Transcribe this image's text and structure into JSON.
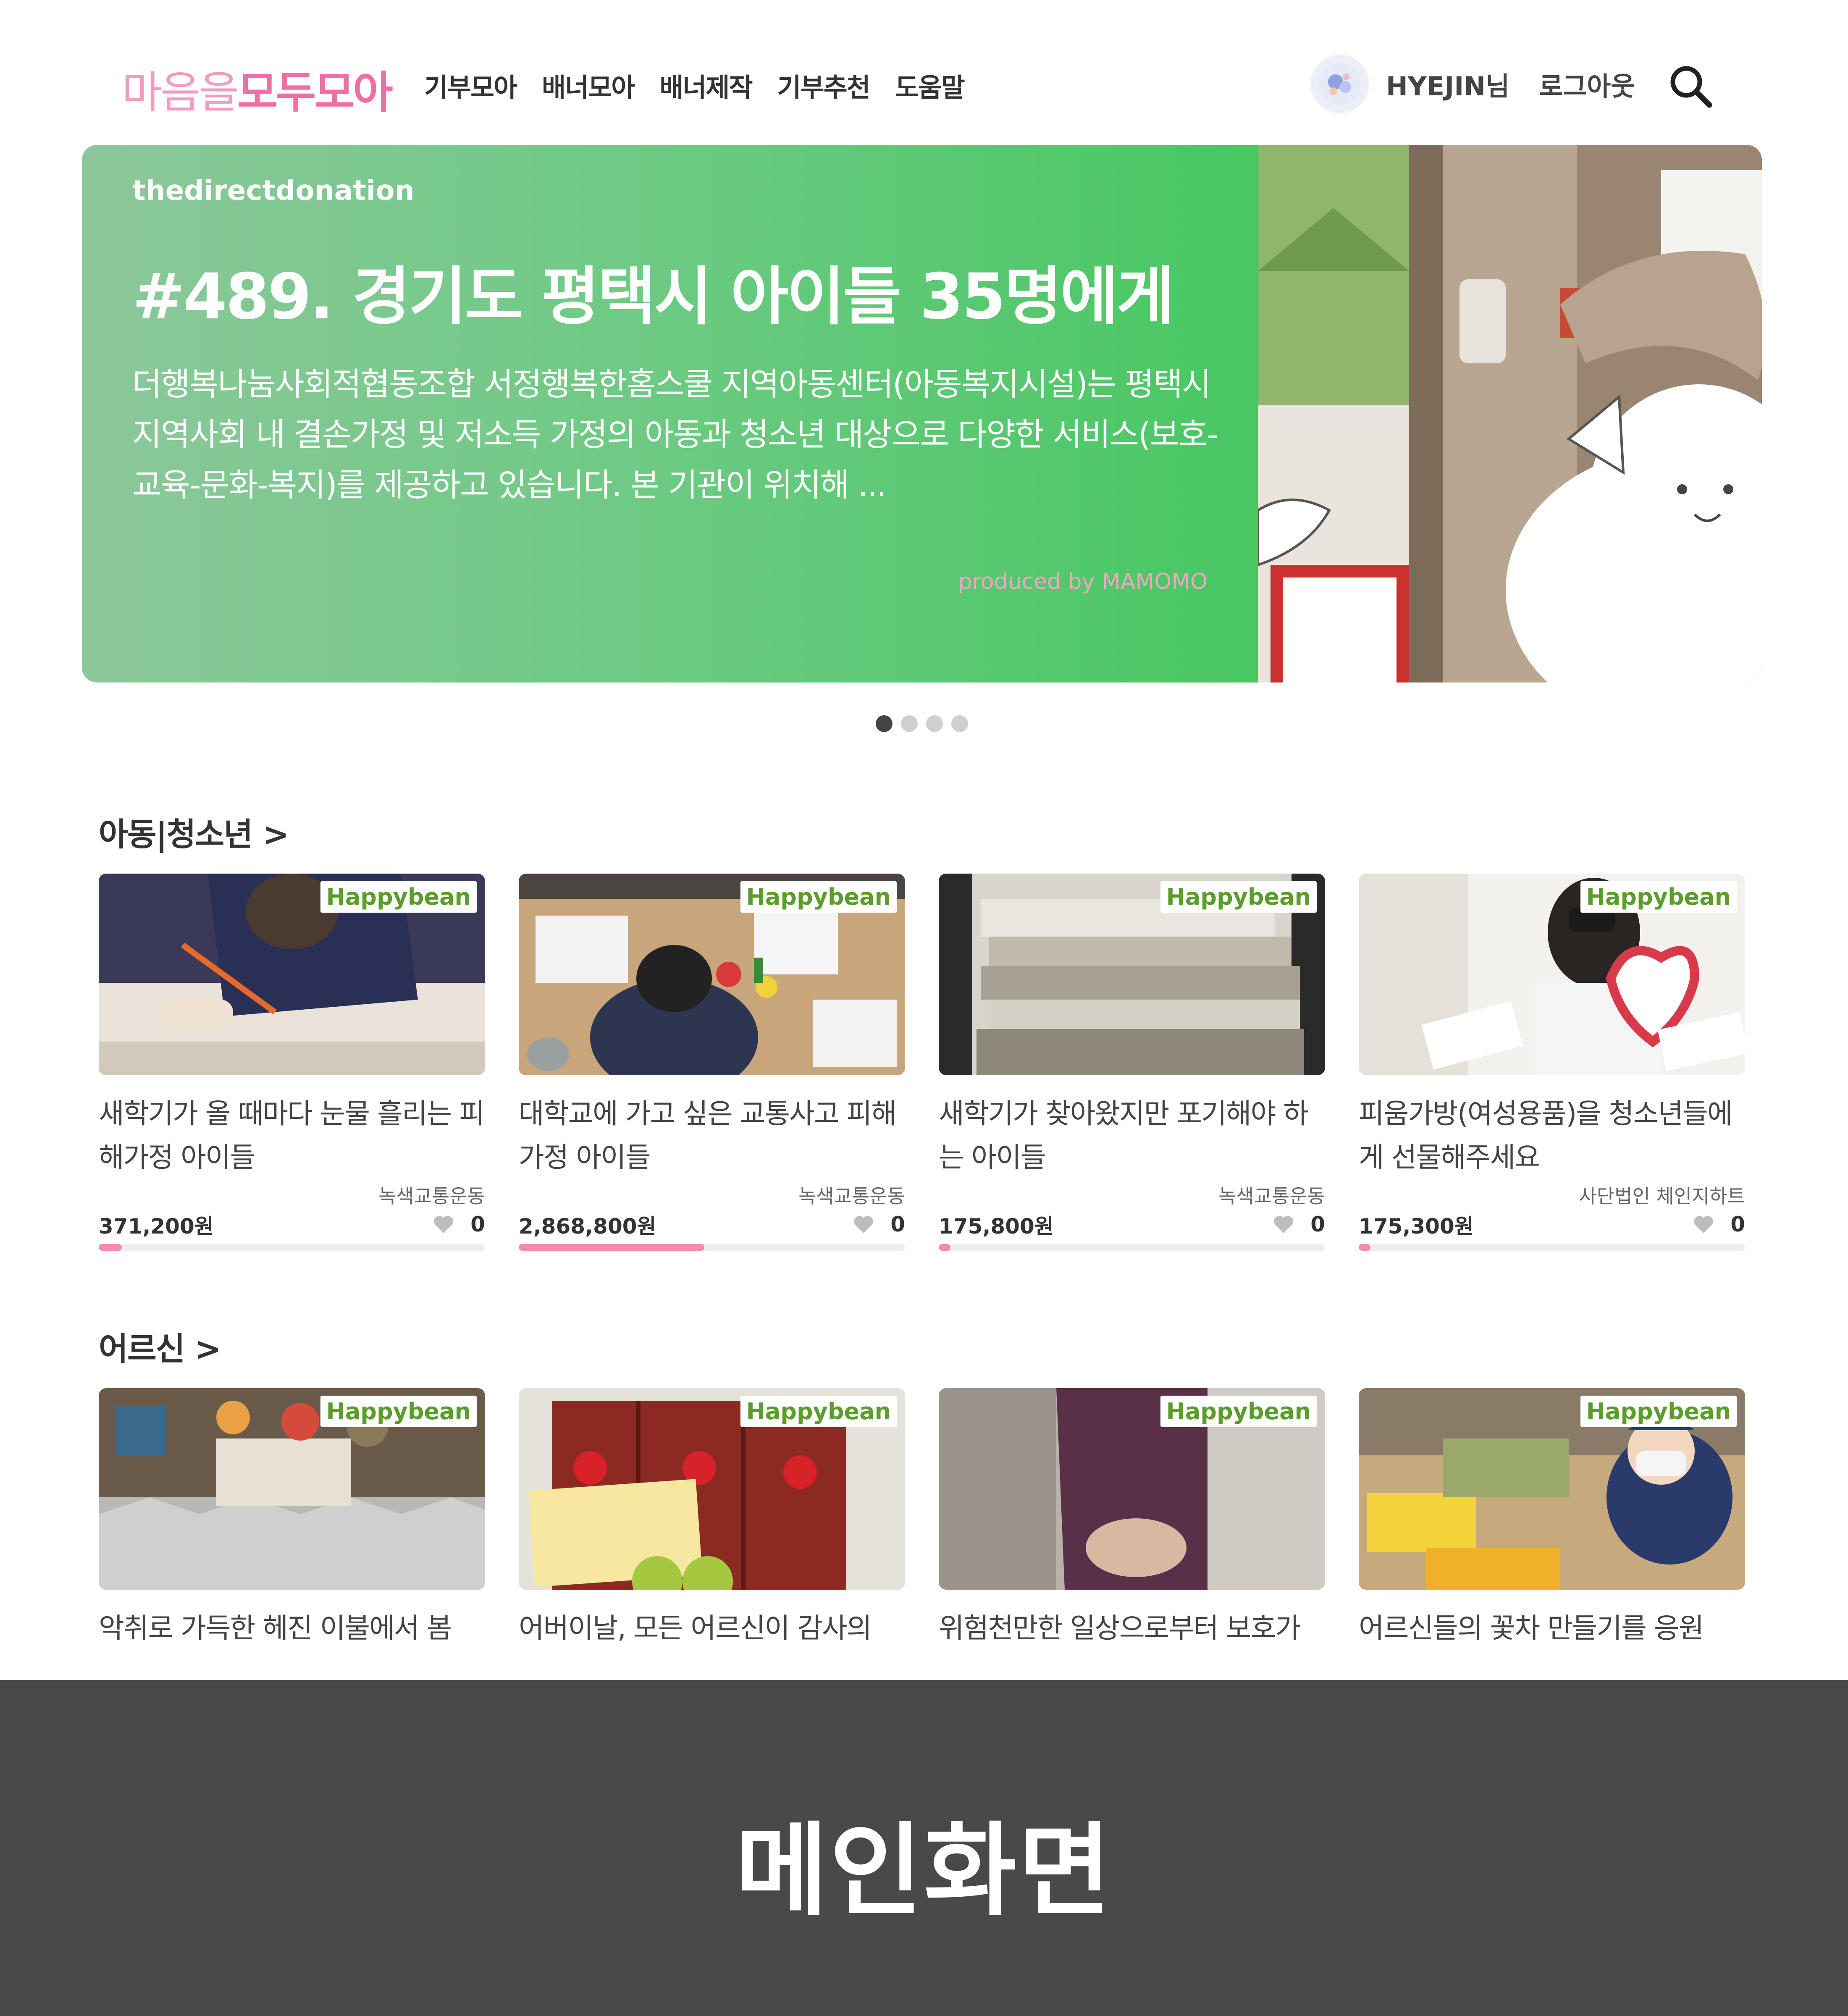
{
  "header": {
    "logo_part1": "마음을",
    "logo_part2": "모두모아",
    "nav": [
      "기부모아",
      "배너모아",
      "배너제작",
      "기부추천",
      "도움말"
    ],
    "user_name": "HYEJIN님",
    "logout_label": "로그아웃"
  },
  "banner": {
    "source": "thedirectdonation",
    "title": "#489. 경기도 평택시 아이들 35명에게",
    "description": "더행복나눔사회적협동조합 서정행복한홈스쿨 지역아동센터(아동복지시설)는 평택시 지역사회 내 결손가정 및 저소득 가정의 아동과 청소년 대상으로 다양한 서비스(보호-교육-문화-복지)를 제공하고 있습니다. 본 기관이 위치해 ...",
    "credit": "produced by MAMOMO",
    "slide_count": 4,
    "active_slide": 1
  },
  "sections": [
    {
      "title": "아동|청소년 >",
      "cards": [
        {
          "badge": "Happybean",
          "title": "새학기가 올 때마다 눈물 흘리는 피해가정 아이들",
          "org": "녹색교통운동",
          "amount": "371,200원",
          "likes": "0",
          "progress_pct": 6
        },
        {
          "badge": "Happybean",
          "title": "대학교에 가고 싶은 교통사고 피해가정 아이들",
          "org": "녹색교통운동",
          "amount": "2,868,800원",
          "likes": "0",
          "progress_pct": 48
        },
        {
          "badge": "Happybean",
          "title": "새학기가 찾아왔지만 포기해야 하는 아이들",
          "org": "녹색교통운동",
          "amount": "175,800원",
          "likes": "0",
          "progress_pct": 3
        },
        {
          "badge": "Happybean",
          "title": "피움가방(여성용품)을 청소년들에게 선물해주세요",
          "org": "사단법인 체인지하트",
          "amount": "175,300원",
          "likes": "0",
          "progress_pct": 3
        }
      ]
    },
    {
      "title": "어르신 >",
      "cards": [
        {
          "badge": "Happybean",
          "title": "악취로 가득한 헤진 이불에서 봄"
        },
        {
          "badge": "Happybean",
          "title": "어버이날, 모든 어르신이 감사의"
        },
        {
          "badge": "Happybean",
          "title": "위험천만한 일상으로부터 보호가"
        },
        {
          "badge": "Happybean",
          "title": "어르신들의 꽃차 만들기를 응원"
        }
      ]
    }
  ],
  "caption": "메인화면",
  "colors": {
    "logo_light": "#f29bc0",
    "logo_dark": "#ee6ea6",
    "banner_green": "#48c762",
    "progress": "#f08bb5",
    "caption_bg": "#494949"
  }
}
